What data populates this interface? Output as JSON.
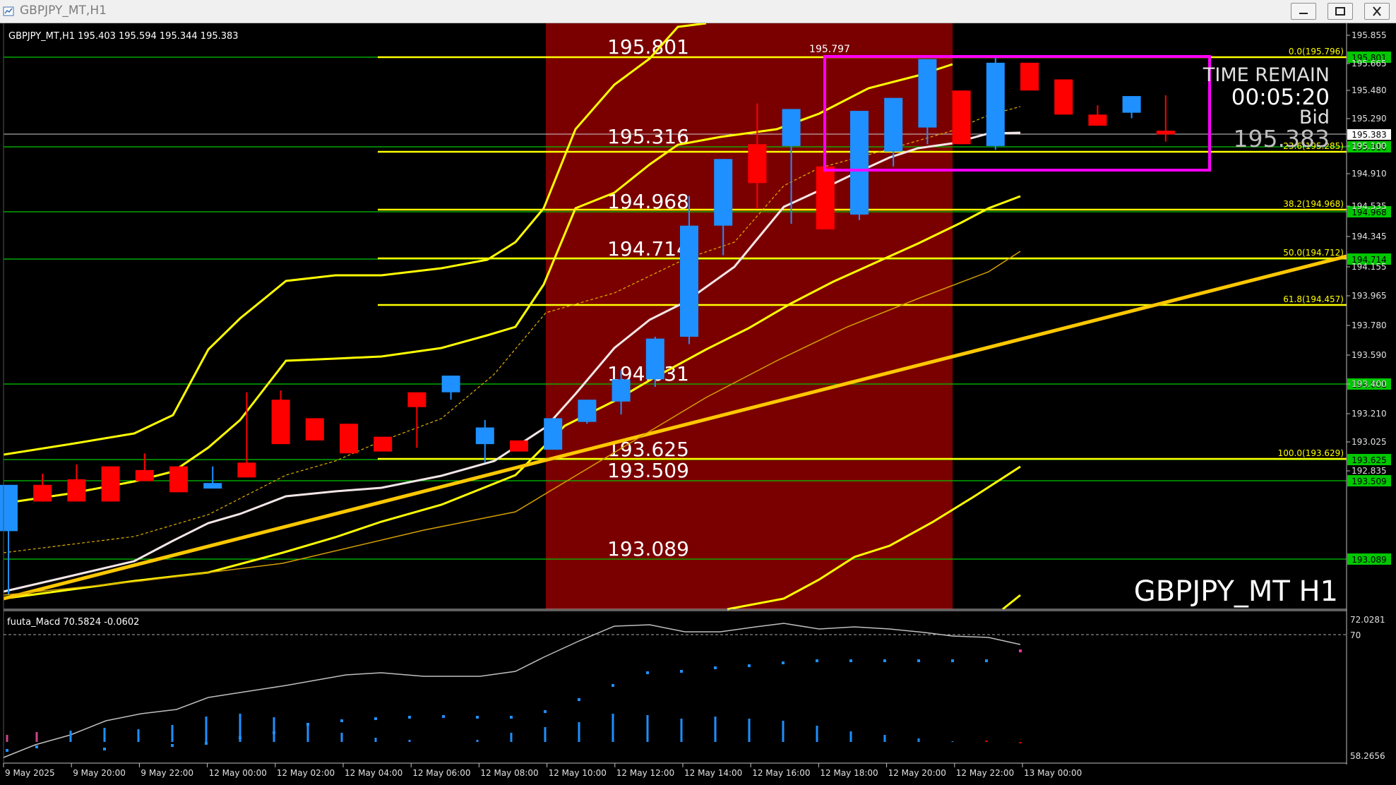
{
  "window": {
    "title": "GBPJPY_MT,H1"
  },
  "chart_info": {
    "symbol_line": "GBPJPY_MT,H1  195.403 195.594 195.344 195.383",
    "watermark": "GBPJPY_MT H1"
  },
  "countdown": {
    "title": "TIME REMAIN",
    "time": "00:05:20",
    "bid_label": "Bid",
    "bid_value": "195.383"
  },
  "macd": {
    "header": "fuuta_Macd 70.5824   -0.0602",
    "axis_top": "72.0281",
    "axis_mid": "70",
    "axis_bottom": "58.2656"
  },
  "colors": {
    "bull": "#1e90ff",
    "bear": "#ff0000",
    "band": "#ffff00",
    "hline": "#00c800",
    "session": "#7a0000",
    "box": "#ff00ff"
  },
  "chart_data": {
    "type": "candlestick",
    "ylim": [
      192.74,
      195.92
    ],
    "x": [
      "9 May 2025",
      "9 May 20:00",
      "9 May 22:00",
      "12 May 00:00",
      "12 May 02:00",
      "12 May 04:00",
      "12 May 06:00",
      "12 May 08:00",
      "12 May 10:00",
      "12 May 12:00",
      "12 May 14:00",
      "12 May 16:00",
      "12 May 18:00",
      "12 May 20:00",
      "12 May 22:00",
      "13 May 00:00"
    ],
    "y_ticks": [
      "195.855",
      "195.665",
      "195.480",
      "195.290",
      "195.100",
      "194.910",
      "194.535",
      "194.345",
      "194.155",
      "193.965",
      "193.780",
      "193.590",
      "193.400",
      "193.210",
      "193.025",
      "192.835"
    ],
    "candles": [
      [
        193.24,
        193.49,
        192.9,
        193.49
      ],
      [
        193.49,
        193.55,
        193.44,
        193.4
      ],
      [
        193.52,
        193.6,
        193.42,
        193.4
      ],
      [
        193.59,
        193.59,
        193.53,
        193.4
      ],
      [
        193.57,
        193.66,
        193.55,
        193.51
      ],
      [
        193.59,
        193.58,
        193.47,
        193.45
      ],
      [
        193.47,
        193.59,
        193.47,
        193.5
      ],
      [
        193.61,
        193.99,
        193.58,
        193.53
      ],
      [
        193.95,
        194.0,
        193.79,
        193.71
      ],
      [
        193.85,
        193.84,
        193.81,
        193.73
      ],
      [
        193.82,
        193.78,
        193.66,
        193.66
      ],
      [
        193.75,
        193.67,
        193.67,
        193.67
      ],
      [
        193.99,
        193.7,
        193.69,
        193.91
      ],
      [
        193.99,
        194.07,
        193.95,
        194.08
      ],
      [
        193.71,
        193.84,
        193.61,
        193.8
      ],
      [
        193.73,
        193.67,
        193.7,
        193.67
      ],
      [
        193.68,
        193.84,
        193.68,
        193.85
      ],
      [
        193.83,
        193.89,
        193.82,
        193.95
      ],
      [
        193.94,
        194.11,
        193.87,
        194.06
      ],
      [
        194.06,
        194.29,
        194.02,
        194.28
      ],
      [
        194.29,
        195.05,
        194.25,
        194.89
      ],
      [
        194.89,
        195.07,
        194.73,
        195.25
      ],
      [
        195.33,
        195.55,
        194.98,
        195.12
      ],
      [
        195.32,
        195.42,
        194.9,
        195.52
      ],
      [
        195.21,
        195.41,
        194.89,
        194.87
      ],
      [
        194.95,
        195.24,
        194.92,
        195.51
      ],
      [
        195.29,
        195.42,
        195.21,
        195.58
      ],
      [
        195.42,
        195.55,
        195.33,
        195.79
      ],
      [
        195.62,
        195.62,
        195.33,
        195.33
      ],
      [
        195.32,
        195.8,
        195.3,
        195.77
      ],
      [
        195.77,
        195.77,
        195.63,
        195.62
      ],
      [
        195.68,
        195.68,
        195.52,
        195.49
      ],
      [
        195.49,
        195.54,
        195.48,
        195.43
      ],
      [
        195.5,
        195.57,
        195.47,
        195.59
      ],
      [
        195.403,
        195.594,
        195.344,
        195.383
      ]
    ],
    "hlines": [
      "195.801",
      "195.316",
      "194.968",
      "194.714",
      "194.031",
      "193.625",
      "193.509",
      "193.089"
    ],
    "hline_tags": [
      "195.801",
      "195.316",
      "194.968",
      "194.714",
      "194.031",
      "193.625",
      "193.509",
      "193.089"
    ],
    "current_price": "195.383",
    "fib_levels": [
      {
        "label": "0.0(195.796)",
        "value": 195.796
      },
      {
        "label": "23.6(195.285)",
        "value": 195.285
      },
      {
        "label": "38.2(194.968)",
        "value": 194.968
      },
      {
        "label": "50.0(194.712)",
        "value": 194.712
      },
      {
        "label": "61.8(194.457)",
        "value": 194.457
      },
      {
        "label": "100.0(193.629)",
        "value": 193.629
      }
    ],
    "high_marker": "195.797"
  }
}
